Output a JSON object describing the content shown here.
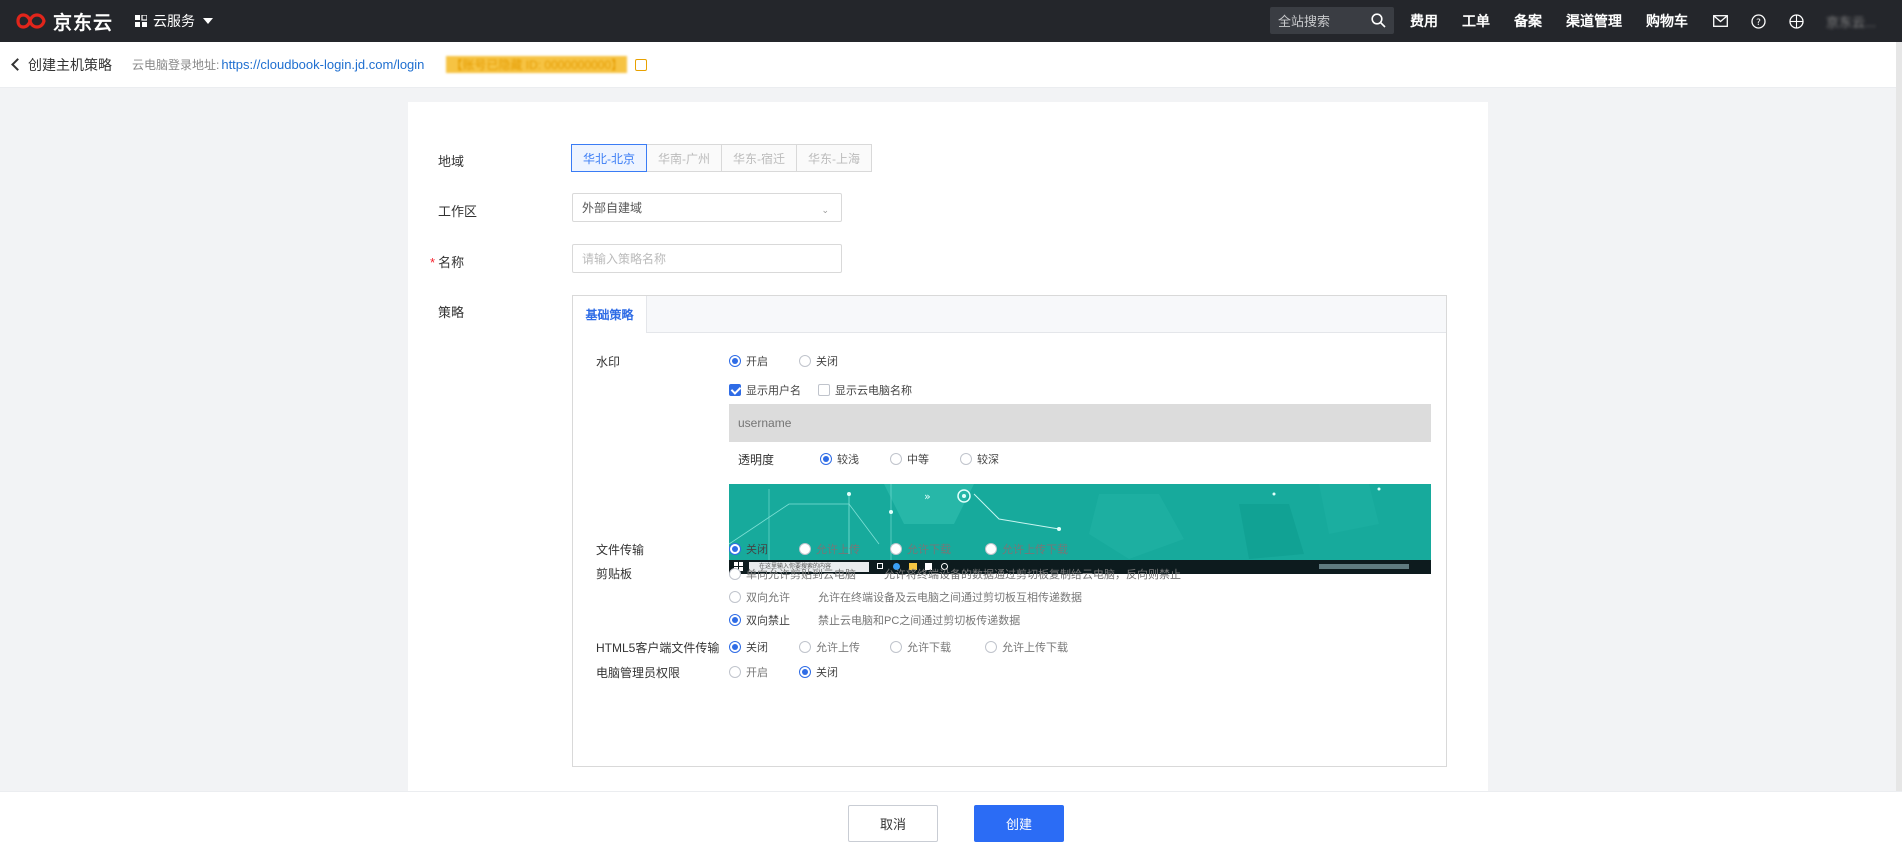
{
  "topbar": {
    "logo_text": "京东云",
    "services_label": "云服务",
    "search_placeholder": "全站搜索",
    "nav": [
      "费用",
      "工单",
      "备案",
      "渠道管理",
      "购物车"
    ],
    "user_label": "京东云..."
  },
  "subbar": {
    "back_label": "创建主机策略",
    "login_label": "云电脑登录地址:",
    "login_url": "https://cloudbook-login.jd.com/login",
    "highlight_text": "【账号已隐藏 ID: 0000000000】"
  },
  "form": {
    "region_label": "地域",
    "regions": [
      "华北-北京",
      "华南-广州",
      "华东-宿迁",
      "华东-上海"
    ],
    "region_selected": "华北-北京",
    "workspace_label": "工作区",
    "workspace_value": "外部自建域",
    "name_label": "名称",
    "name_required_mark": "*",
    "name_placeholder": "请输入策略名称",
    "policy_label": "策略"
  },
  "policy": {
    "tab_label": "基础策略",
    "watermark": {
      "label": "水印",
      "options": [
        "开启",
        "关闭"
      ],
      "selected": "开启",
      "show_username": "显示用户名",
      "show_username_checked": true,
      "show_pc_name": "显示云电脑名称",
      "show_pc_name_checked": false,
      "input_placeholder": "username",
      "opacity_label": "透明度",
      "opacity_options": [
        "较浅",
        "中等",
        "较深"
      ],
      "opacity_selected": "较浅",
      "preview_taskbar_search": "在这里输入你要搜索的内容"
    },
    "file_transfer": {
      "label": "文件传输",
      "options": [
        "关闭",
        "允许上传",
        "允许下载",
        "允许上传下载"
      ],
      "selected": "关闭"
    },
    "clipboard": {
      "label": "剪贴板",
      "options": [
        {
          "name": "单向允许剪贴到云电脑",
          "desc": "允许将终端设备的数据通过剪切板复制给云电脑，反向则禁止"
        },
        {
          "name": "双向允许",
          "desc": "允许在终端设备及云电脑之间通过剪切板互相传递数据"
        },
        {
          "name": "双向禁止",
          "desc": "禁止云电脑和PC之间通过剪切板传递数据"
        }
      ],
      "selected": "双向禁止"
    },
    "html5_transfer": {
      "label": "HTML5客户端文件传输",
      "options": [
        "关闭",
        "允许上传",
        "允许下载",
        "允许上传下载"
      ],
      "selected": "关闭"
    },
    "admin": {
      "label": "电脑管理员权限",
      "options": [
        "开启",
        "关闭"
      ],
      "selected": "关闭"
    }
  },
  "footer": {
    "cancel_label": "取消",
    "create_label": "创建"
  },
  "colors": {
    "topbar_bg": "#24262b",
    "accent": "#2b6cf5",
    "brand_red": "#e1251b"
  }
}
